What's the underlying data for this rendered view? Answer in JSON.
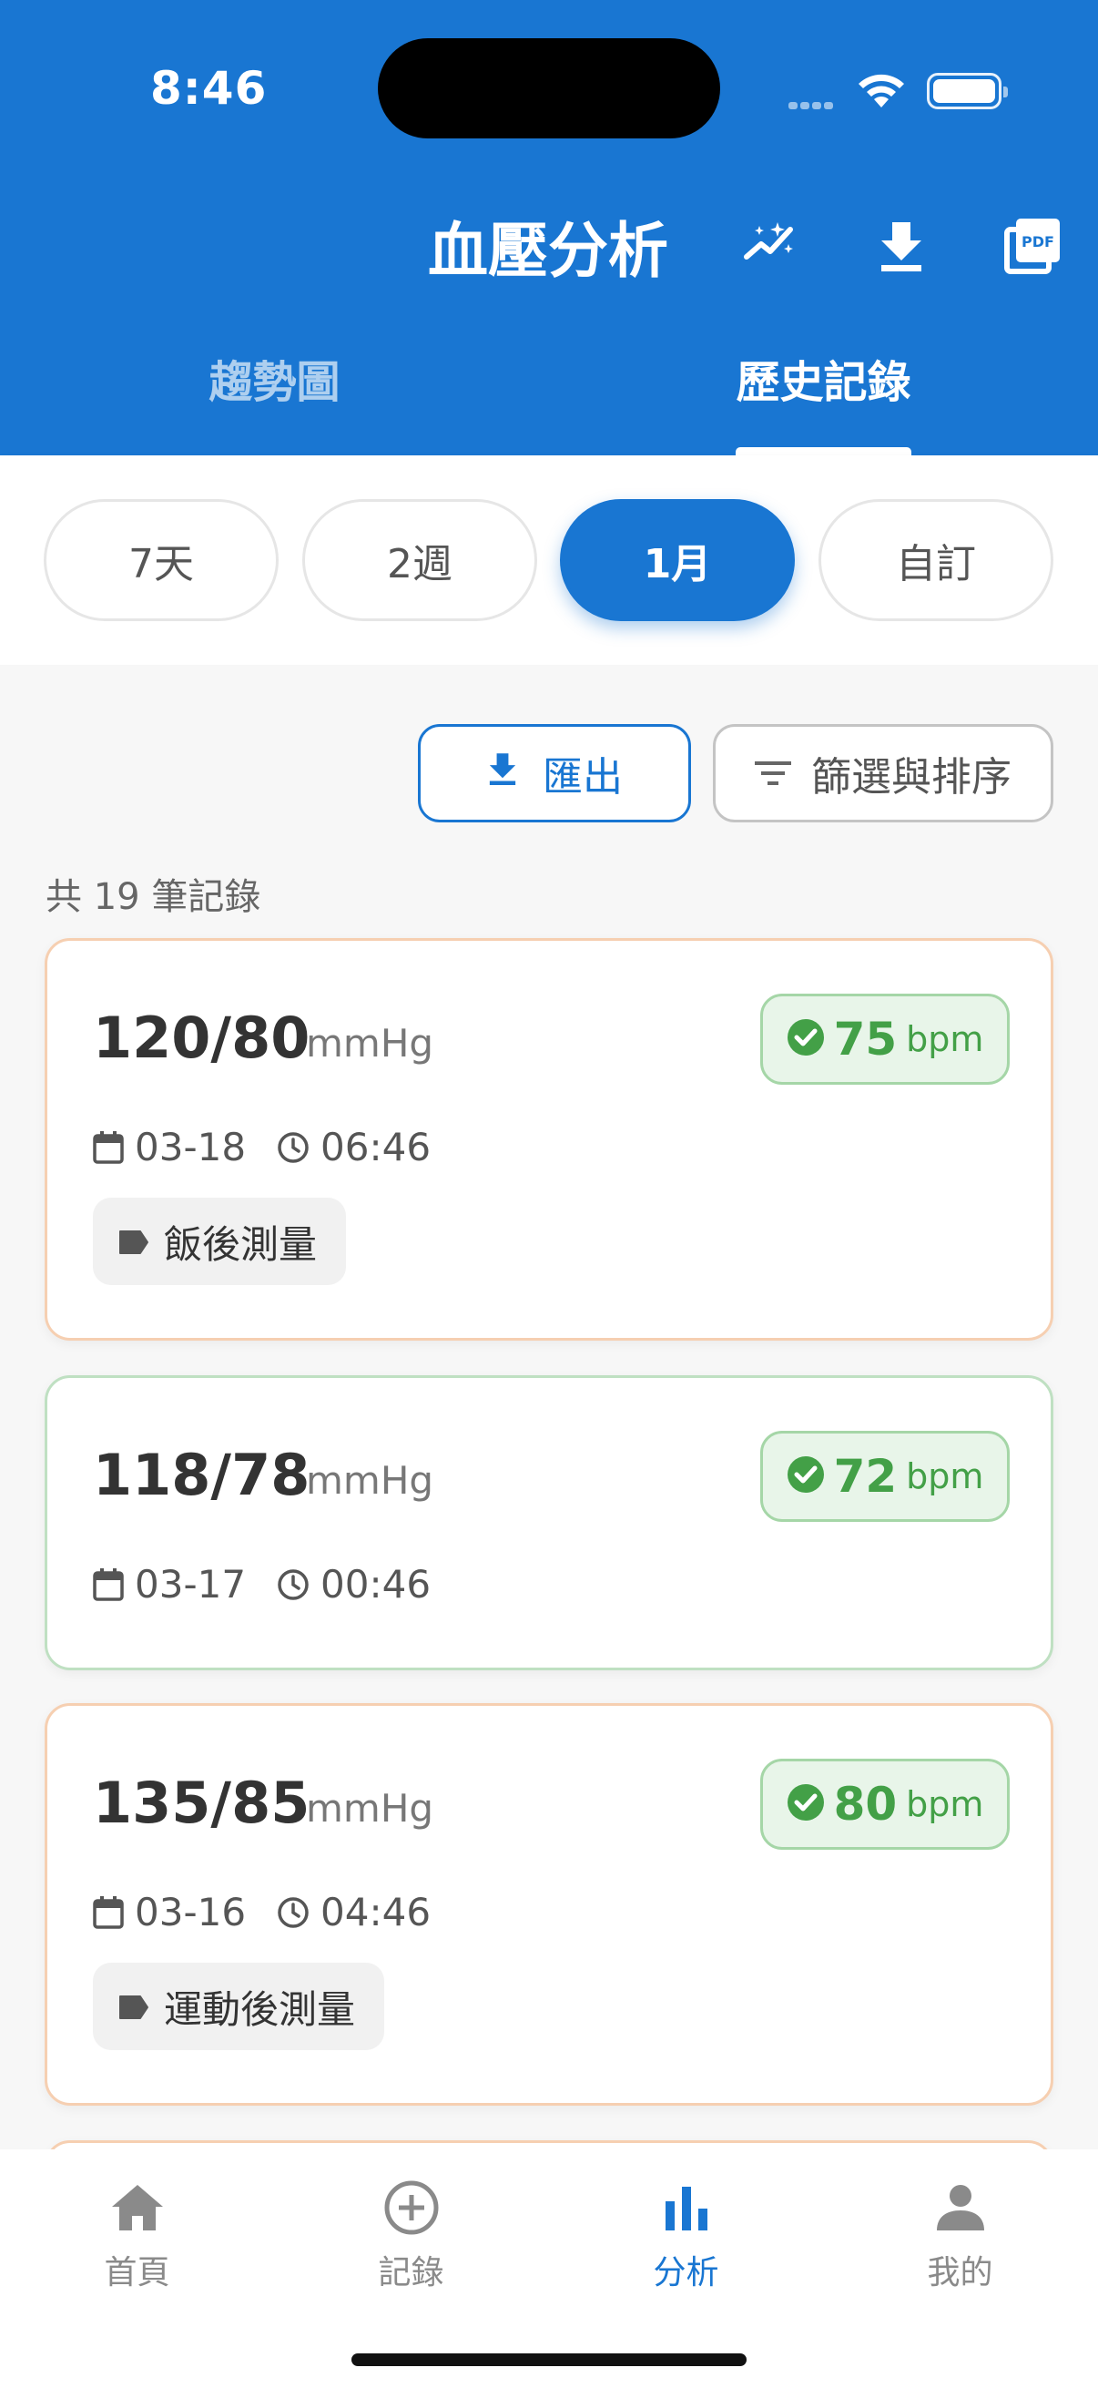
{
  "status_bar": {
    "time": "8:46"
  },
  "header": {
    "title": "血壓分析",
    "tabs": [
      {
        "label": "趨勢圖",
        "active": false
      },
      {
        "label": "歷史記錄",
        "active": true
      }
    ],
    "actions": [
      "magic-wand-icon",
      "download-icon",
      "pdf-icon"
    ]
  },
  "periods": [
    {
      "label": "7天",
      "selected": false
    },
    {
      "label": "2週",
      "selected": false
    },
    {
      "label": "1月",
      "selected": true
    },
    {
      "label": "自訂",
      "selected": false
    }
  ],
  "toolbar": {
    "export_label": "匯出",
    "filter_label": "篩選與排序"
  },
  "summary": {
    "count_text": "共 19 筆記錄"
  },
  "records": [
    {
      "bp": "120/80",
      "unit": "mmHg",
      "pulse": "75",
      "pulse_unit": "bpm",
      "date": "03-18",
      "time": "06:46",
      "tag": "飯後測量"
    },
    {
      "bp": "118/78",
      "unit": "mmHg",
      "pulse": "72",
      "pulse_unit": "bpm",
      "date": "03-17",
      "time": "00:46",
      "tag": ""
    },
    {
      "bp": "135/85",
      "unit": "mmHg",
      "pulse": "80",
      "pulse_unit": "bpm",
      "date": "03-16",
      "time": "04:46",
      "tag": "運動後測量"
    }
  ],
  "colors": {
    "primary": "#1976D2",
    "normal_green": "#43A047",
    "warn_orange_border": "#F6CFB1"
  },
  "bottom_nav": [
    {
      "label": "首頁",
      "icon": "home-icon",
      "active": false
    },
    {
      "label": "記錄",
      "icon": "add-circle-icon",
      "active": false
    },
    {
      "label": "分析",
      "icon": "bar-chart-icon",
      "active": true
    },
    {
      "label": "我的",
      "icon": "person-icon",
      "active": false
    }
  ]
}
